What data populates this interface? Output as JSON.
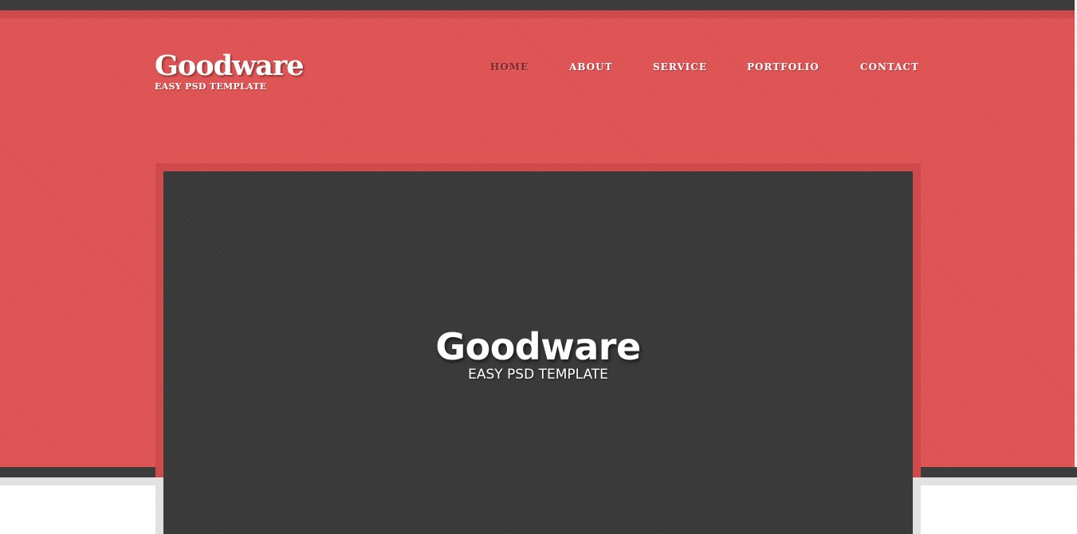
{
  "header": {
    "logo_title": "Goodware",
    "logo_subtitle": "EASY PSD TEMPLATE"
  },
  "nav": {
    "items": [
      {
        "label": "HOME",
        "active": true
      },
      {
        "label": "ABOUT",
        "active": false
      },
      {
        "label": "SERVICE",
        "active": false
      },
      {
        "label": "PORTFOLIO",
        "active": false
      },
      {
        "label": "CONTACT",
        "active": false
      }
    ]
  },
  "hero": {
    "title": "Goodware",
    "subtitle": "EASY PSD TEMPLATE"
  },
  "colors": {
    "brand_red": "#e05454",
    "dark_bar": "#3c3c3c",
    "slider_bg": "#3a3a3a",
    "active_nav": "#7a2a2a",
    "text": "#ffffff"
  }
}
